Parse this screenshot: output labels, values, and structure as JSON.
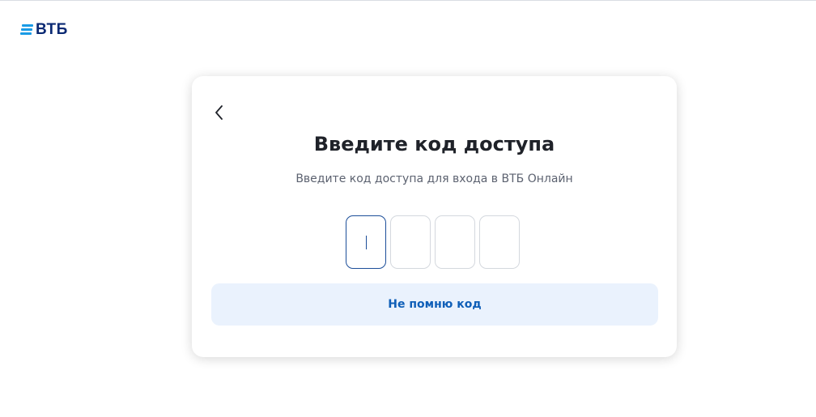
{
  "header": {
    "logo_text": "ВТБ",
    "brand_color": "#0a2973",
    "accent_color": "#1a9be6"
  },
  "card": {
    "back_icon": "chevron-left-icon",
    "title": "Введите код доступа",
    "subtitle": "Введите код доступа для входа в ВТБ Онлайн",
    "code": {
      "length": 4,
      "values": [
        "",
        "",
        "",
        ""
      ],
      "focused_index": 0
    },
    "forgot_button_label": "Не помню код",
    "forgot_button_color": "#0f5fb8"
  }
}
